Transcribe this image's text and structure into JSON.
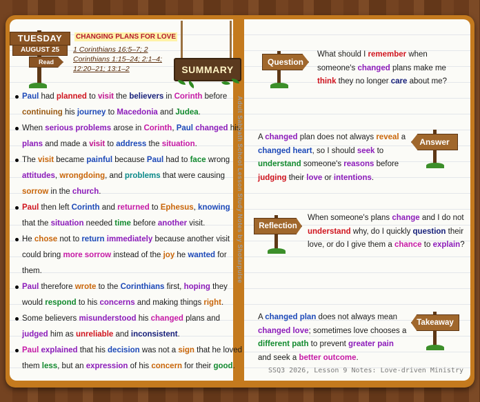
{
  "day_sign": {
    "day": "TUESDAY",
    "date": "AUGUST 25",
    "read": "Read"
  },
  "lesson_title": "CHANGING PLANS FOR LOVE",
  "references": [
    "1 Corinthians 16:5–7; 2",
    "Corinthians 1:15–24; 2:1–4;",
    "12:20–21; 13:1–2"
  ],
  "summary_label": "SUMMARY",
  "watermark": "Adult Sabbath School Lesson Study Notes by Shotarpulse",
  "footer": "SSQ3 2026, Lesson 9 Notes: Love-driven Ministry",
  "bullets": [
    [
      [
        "Paul",
        "blue"
      ],
      [
        " had "
      ],
      [
        "planned",
        "red"
      ],
      [
        " to "
      ],
      [
        "visit",
        "pink"
      ],
      [
        " the "
      ],
      [
        "believers",
        "navy"
      ],
      [
        " in "
      ],
      [
        "Corinth",
        "magenta"
      ],
      [
        " before "
      ],
      [
        "continuing",
        "brown"
      ],
      [
        " his "
      ],
      [
        "journey",
        "blue"
      ],
      [
        " to "
      ],
      [
        "Macedonia",
        "purple"
      ],
      [
        " and "
      ],
      [
        "Judea",
        "green"
      ],
      [
        "."
      ]
    ],
    [
      [
        "When "
      ],
      [
        "serious problems",
        "purple"
      ],
      [
        " arose in "
      ],
      [
        "Corinth",
        "magenta"
      ],
      [
        ", "
      ],
      [
        "Paul",
        "blue"
      ],
      [
        " "
      ],
      [
        "changed",
        "purple"
      ],
      [
        " his "
      ],
      [
        "plans",
        "purple"
      ],
      [
        " and made a "
      ],
      [
        "visit",
        "pink"
      ],
      [
        " to "
      ],
      [
        "address",
        "blue"
      ],
      [
        " the "
      ],
      [
        "situation",
        "magenta"
      ],
      [
        "."
      ]
    ],
    [
      [
        "The "
      ],
      [
        "visit",
        "orange"
      ],
      [
        " became "
      ],
      [
        "painful",
        "blue"
      ],
      [
        " because "
      ],
      [
        "Paul",
        "blue"
      ],
      [
        " had to "
      ],
      [
        "face",
        "green"
      ],
      [
        " wrong "
      ],
      [
        "attitudes",
        "purple"
      ],
      [
        ", "
      ],
      [
        "wrongdoing",
        "orange"
      ],
      [
        ", and "
      ],
      [
        "problems",
        "teal"
      ],
      [
        " that were causing "
      ],
      [
        "sorrow",
        "orange"
      ],
      [
        " in the "
      ],
      [
        "church",
        "purple"
      ],
      [
        "."
      ]
    ],
    [
      [
        "Paul",
        "red"
      ],
      [
        " then left "
      ],
      [
        "Corinth",
        "blue"
      ],
      [
        " and "
      ],
      [
        "returned",
        "magenta"
      ],
      [
        " to "
      ],
      [
        "Ephesus",
        "orange"
      ],
      [
        ", "
      ],
      [
        "knowing",
        "blue"
      ],
      [
        " that the "
      ],
      [
        "situation",
        "purple"
      ],
      [
        " needed "
      ],
      [
        "time",
        "green"
      ],
      [
        " before "
      ],
      [
        "another",
        "purple"
      ],
      [
        " visit."
      ]
    ],
    [
      [
        "He "
      ],
      [
        "chose",
        "orange"
      ],
      [
        " not to "
      ],
      [
        "return",
        "blue"
      ],
      [
        " "
      ],
      [
        "immediately",
        "purple"
      ],
      [
        " because another visit could bring "
      ],
      [
        "more sorrow",
        "magenta"
      ],
      [
        " instead of the "
      ],
      [
        "joy",
        "orange"
      ],
      [
        " he "
      ],
      [
        "wanted",
        "blue"
      ],
      [
        " for them."
      ]
    ],
    [
      [
        "Paul",
        "purple"
      ],
      [
        " therefore "
      ],
      [
        "wrote",
        "orange"
      ],
      [
        " to the "
      ],
      [
        "Corinthians",
        "blue"
      ],
      [
        " first, "
      ],
      [
        "hoping",
        "purple"
      ],
      [
        " they would "
      ],
      [
        "respond",
        "green"
      ],
      [
        " to his "
      ],
      [
        "concerns",
        "purple"
      ],
      [
        " and making things "
      ],
      [
        "right",
        "orange"
      ],
      [
        "."
      ]
    ],
    [
      [
        "Some believers "
      ],
      [
        "misunderstood",
        "purple"
      ],
      [
        " his "
      ],
      [
        "changed",
        "magenta"
      ],
      [
        " plans and "
      ],
      [
        "judged",
        "purple"
      ],
      [
        " him as "
      ],
      [
        "unreliable",
        "red"
      ],
      [
        " and "
      ],
      [
        "inconsistent",
        "navy"
      ],
      [
        "."
      ]
    ],
    [
      [
        "Paul",
        "magenta"
      ],
      [
        " "
      ],
      [
        "explained",
        "purple"
      ],
      [
        " that his "
      ],
      [
        "decision",
        "blue"
      ],
      [
        " was not a "
      ],
      [
        "sign",
        "orange"
      ],
      [
        " that he loved them "
      ],
      [
        "less",
        "green"
      ],
      [
        ", but an "
      ],
      [
        "expression",
        "purple"
      ],
      [
        " of his "
      ],
      [
        "concern",
        "orange"
      ],
      [
        " for their "
      ],
      [
        "good",
        "green"
      ],
      [
        "."
      ]
    ]
  ],
  "question": {
    "label": "Question",
    "text": [
      [
        "What should I "
      ],
      [
        "remember",
        "red"
      ],
      [
        " when someone's "
      ],
      [
        "changed",
        "purple"
      ],
      [
        " plans make me "
      ],
      [
        "think",
        "red"
      ],
      [
        " they no longer "
      ],
      [
        "care",
        "navy"
      ],
      [
        " about me?"
      ]
    ]
  },
  "answer": {
    "label": "Answer",
    "text": [
      [
        "A "
      ],
      [
        "changed",
        "purple"
      ],
      [
        " plan does not always "
      ],
      [
        "reveal",
        "orange"
      ],
      [
        " a "
      ],
      [
        "changed heart",
        "blue"
      ],
      [
        ", so I should "
      ],
      [
        "seek",
        "purple"
      ],
      [
        " to "
      ],
      [
        "understand",
        "green"
      ],
      [
        " someone's "
      ],
      [
        "reasons",
        "purple"
      ],
      [
        " before "
      ],
      [
        "judging",
        "red"
      ],
      [
        " their "
      ],
      [
        "love",
        "purple"
      ],
      [
        " or "
      ],
      [
        "intentions",
        "purple"
      ],
      [
        "."
      ]
    ]
  },
  "reflection": {
    "label": "Reflection",
    "text": [
      [
        "When someone's plans "
      ],
      [
        "change",
        "purple"
      ],
      [
        " and I do not "
      ],
      [
        "understand",
        "red"
      ],
      [
        " why, do I quickly "
      ],
      [
        "question",
        "navy"
      ],
      [
        " their love, or do I give them a "
      ],
      [
        "chance",
        "magenta"
      ],
      [
        " to "
      ],
      [
        "explain",
        "purple"
      ],
      [
        "?"
      ]
    ]
  },
  "takeaway": {
    "label": "Takeaway",
    "text": [
      [
        "A "
      ],
      [
        "changed plan",
        "blue"
      ],
      [
        " does not always mean "
      ],
      [
        "changed love",
        "purple"
      ],
      [
        "; sometimes love chooses a "
      ],
      [
        "different path",
        "green"
      ],
      [
        " to prevent "
      ],
      [
        "greater pain",
        "purple"
      ],
      [
        " and seek a "
      ],
      [
        "better outcome",
        "magenta"
      ],
      [
        "."
      ]
    ]
  },
  "colors": {
    "red": "#d0141e",
    "blue": "#1d49b8",
    "green": "#128a2e",
    "purple": "#8c1cba",
    "pink": "#c0148f",
    "orange": "#c9660a",
    "navy": "#17207a",
    "teal": "#0c8a8a",
    "brown": "#9a5a12",
    "magenta": "#c61aa6",
    "cover": "#c47a1e"
  }
}
